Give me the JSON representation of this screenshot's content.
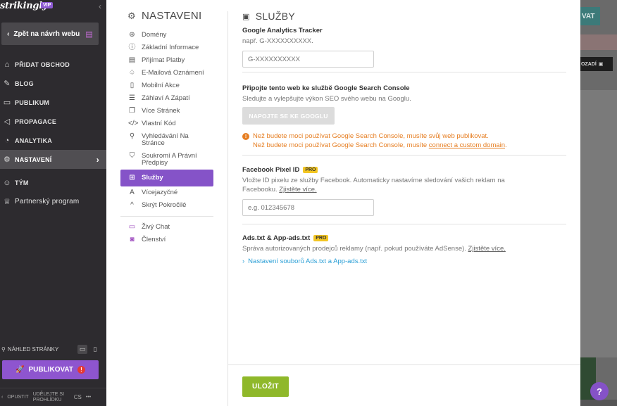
{
  "brand": {
    "logo": "strikingly",
    "badge": "VIP"
  },
  "sidebar": {
    "back_label": "Zpět na návrh webu",
    "items": [
      {
        "label": "PŘIDAT OBCHOD",
        "icon": "store-icon"
      },
      {
        "label": "BLOG",
        "icon": "pen-icon"
      },
      {
        "label": "PUBLIKUM",
        "icon": "chat-icon"
      },
      {
        "label": "PROPAGACE",
        "icon": "megaphone-icon"
      },
      {
        "label": "ANALYTIKA",
        "icon": "pie-chart-icon"
      },
      {
        "label": "NASTAVENÍ",
        "icon": "gear-icon",
        "active": true
      }
    ],
    "extra_items": [
      {
        "label": "TÝM",
        "icon": "team-icon"
      },
      {
        "label": "Partnerský program",
        "icon": "trophy-icon"
      }
    ],
    "preview_label": "NÁHLED STRÁNKY",
    "publish_label": "PUBLIKOVAT",
    "footer": {
      "exit": "OPUSTIT",
      "tour": "UDĚLEJTE SI PROHLÍDKU",
      "lang": "CS",
      "more": "•••"
    }
  },
  "settings_menu": {
    "title": "NASTAVENI",
    "items": [
      {
        "label": "Domény",
        "icon": "globe-icon"
      },
      {
        "label": "Základní Informace",
        "icon": "info-icon"
      },
      {
        "label": "Přijímat Platby",
        "icon": "payment-icon"
      },
      {
        "label": "E-Mailová Oznámení",
        "icon": "bell-icon"
      },
      {
        "label": "Mobilní Akce",
        "icon": "mobile-icon"
      },
      {
        "label": "Záhlaví A Zápatí",
        "icon": "header-footer-icon"
      },
      {
        "label": "Více Stránek",
        "icon": "pages-icon"
      },
      {
        "label": "Vlastní Kód",
        "icon": "code-icon"
      },
      {
        "label": "Vyhledávání Na Stránce",
        "icon": "search-icon"
      },
      {
        "label": "Soukromí A Právní Předpisy",
        "icon": "shield-icon"
      },
      {
        "label": "Služby",
        "icon": "grid-icon",
        "active": true
      },
      {
        "label": "Vícejazyčné",
        "icon": "language-icon"
      },
      {
        "label": "Skrýt Pokročilé",
        "icon": "chevron-up-icon"
      }
    ],
    "extra_items": [
      {
        "label": "Živý Chat",
        "icon": "chat-bubble-icon"
      },
      {
        "label": "Členství",
        "icon": "membership-icon"
      }
    ]
  },
  "main": {
    "title": "SLUŽBY",
    "ga": {
      "label": "Google Analytics Tracker",
      "desc": "např. G-XXXXXXXXXX.",
      "placeholder": "G-XXXXXXXXXX"
    },
    "gsc": {
      "label": "Připojte tento web ke službě Google Search Console",
      "desc": "Sledujte a vylepšujte výkon SEO svého webu na Googlu.",
      "button": "NAPOJTE SE KE GOOGLU",
      "warn1": "Než budete moci používat Google Search Console, musíte svůj web publikovat.",
      "warn2_prefix": "Než budete moci používat Google Search Console, musíte ",
      "warn2_link": "connect a custom domain",
      "warn2_suffix": "."
    },
    "fb": {
      "label": "Facebook Pixel ID",
      "badge": "PRO",
      "desc": "Vložte ID pixelu ze služby Facebook. Automaticky nastavíme sledování vašich reklam na Facebooku.",
      "link": "Zjistěte více.",
      "placeholder": "e.g. 012345678"
    },
    "ads": {
      "label": "Ads.txt & App-ads.txt",
      "badge": "PRO",
      "desc": "Správa autorizovaných prodejců reklamy (např. pokud používáte AdSense).",
      "link": "Zjistěte více.",
      "setup_link": "Nastavení souborů Ads.txt a App-ads.txt"
    },
    "save_label": "ULOŽIT"
  },
  "preview": {
    "button_text": "VAT",
    "bar_text": "OZADÍ"
  },
  "help_label": "?",
  "colors": {
    "accent": "#8553c8",
    "save": "#8fb82a",
    "warning": "#e67e22",
    "link": "#2b9fd6",
    "sidebar_bg": "#2d2b2f"
  }
}
